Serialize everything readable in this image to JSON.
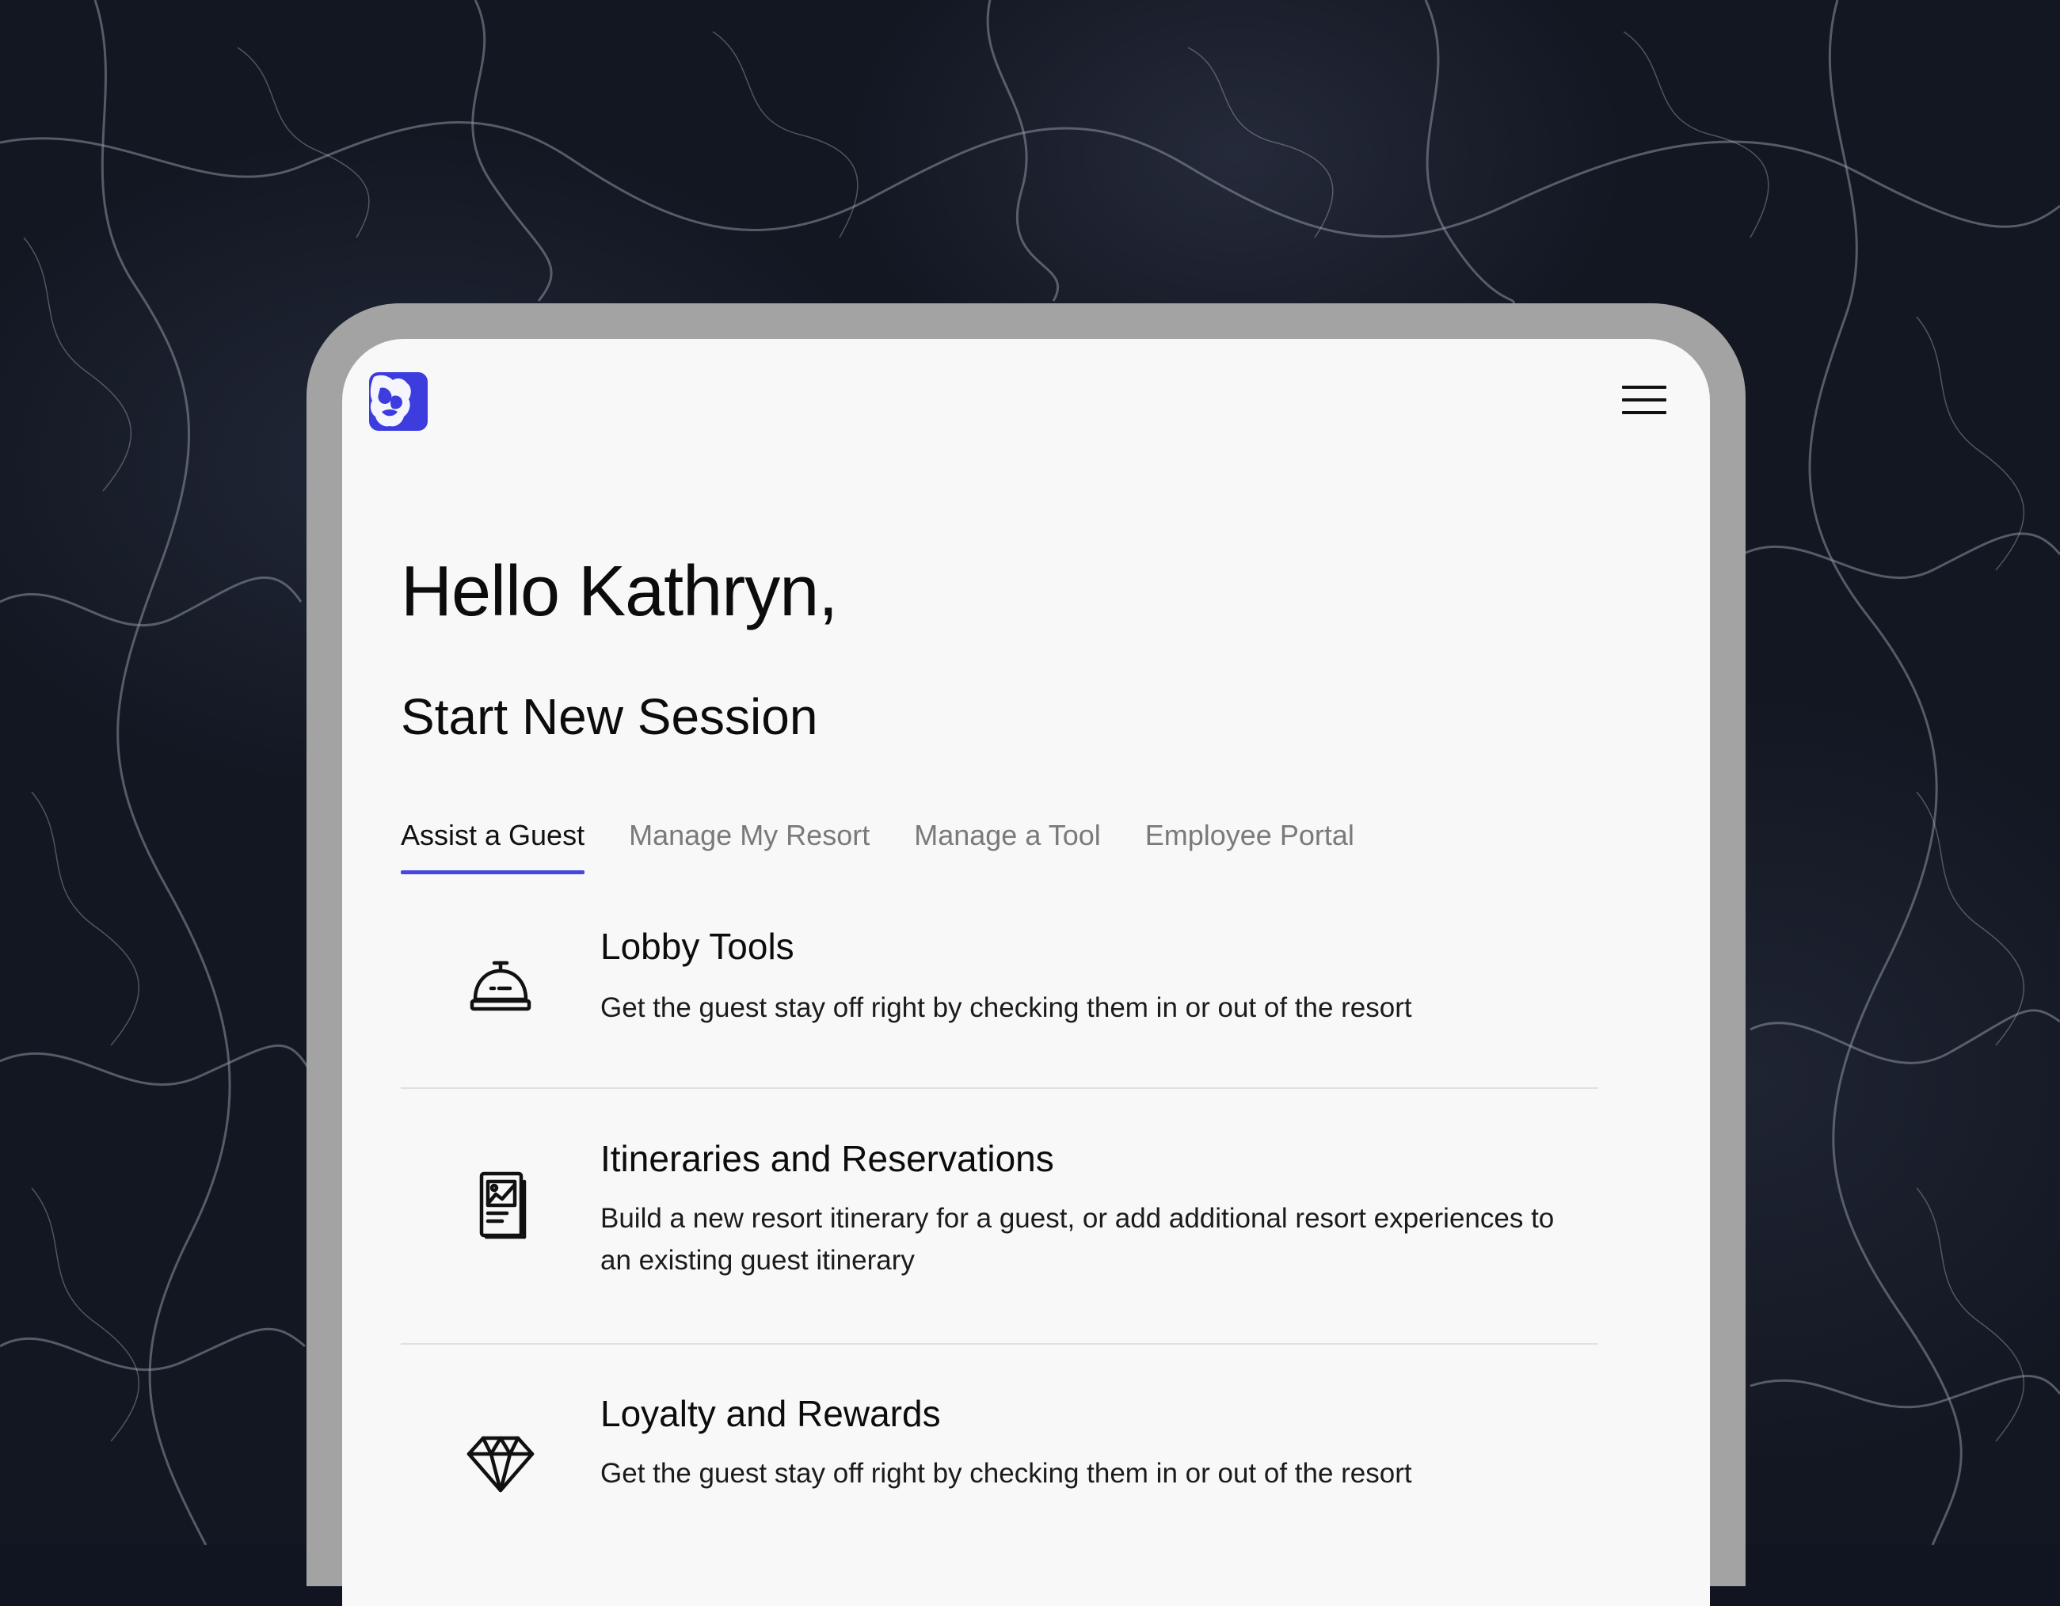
{
  "app": {
    "logo_icon": "lion-head-logo-icon",
    "menu_icon": "hamburger-menu-icon",
    "brand_color": "#3d3ddf"
  },
  "greeting": "Hello Kathryn,",
  "section_title": "Start New Session",
  "tabs": [
    {
      "label": "Assist a Guest",
      "active": true
    },
    {
      "label": "Manage My Resort",
      "active": false
    },
    {
      "label": "Manage a Tool",
      "active": false
    },
    {
      "label": "Employee Portal",
      "active": false
    }
  ],
  "options": [
    {
      "icon": "service-bell-icon",
      "title": "Lobby Tools",
      "description": "Get the guest stay off right by checking them in or out of the resort"
    },
    {
      "icon": "itinerary-document-icon",
      "title": "Itineraries and Reservations",
      "description": "Build a new resort itinerary for a guest, or add additional resort experiences to an existing guest itinerary"
    },
    {
      "icon": "diamond-icon",
      "title": "Loyalty and Rewards",
      "description": "Get the guest stay off right by checking them in or out of the resort"
    }
  ],
  "colors": {
    "tab_active_underline": "#4646e0",
    "tab_inactive_text": "#7a7a7a",
    "device_frame": "#a3a3a4",
    "screen_background": "#f8f8f8"
  }
}
